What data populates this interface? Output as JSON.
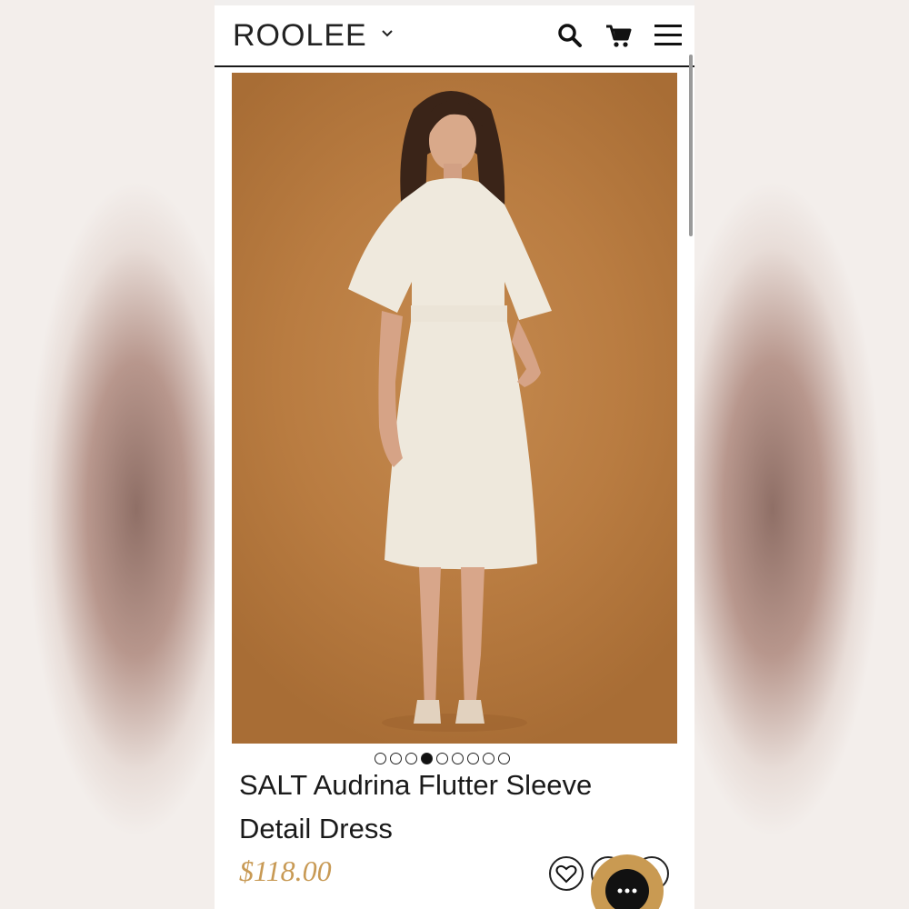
{
  "header": {
    "logo": "ROOLEE",
    "icons": [
      "chevron-down-icon",
      "search-icon",
      "cart-icon",
      "menu-icon"
    ]
  },
  "product": {
    "carousel": {
      "total": 9,
      "active_index": 3
    },
    "title": "SALT Audrina Flutter Sleeve Detail Dress",
    "price": "$118.00",
    "actions": [
      "heart-icon",
      "share-icon",
      "more-icon"
    ]
  },
  "chat": {
    "icon": "chat-dots-icon"
  },
  "colors": {
    "price": "#c89a55",
    "photo_background": "#b97c41",
    "chat_button": "#c99a52"
  }
}
